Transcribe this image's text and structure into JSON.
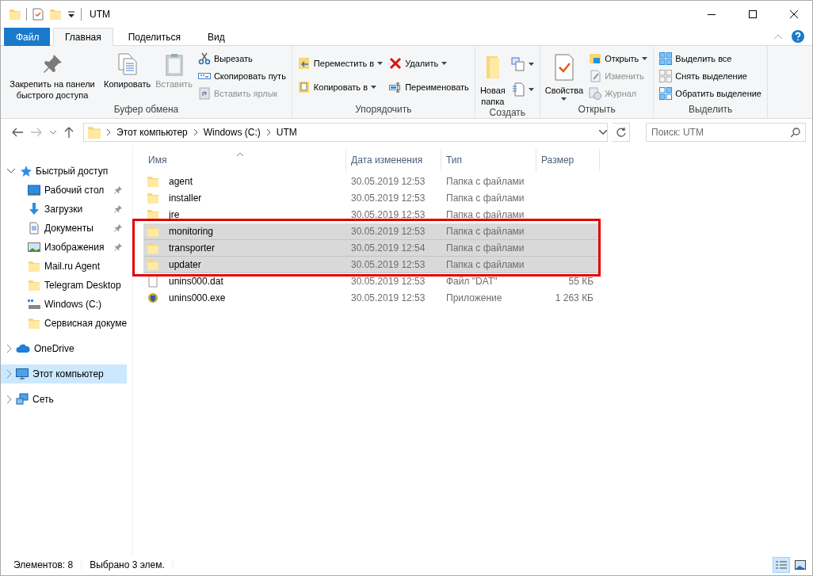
{
  "window": {
    "title": "UTM"
  },
  "ribbon_tabs": [
    {
      "label": "Файл",
      "kind": "file",
      "selected": false
    },
    {
      "label": "Главная",
      "kind": "tab",
      "selected": true
    },
    {
      "label": "Поделиться",
      "kind": "tab",
      "selected": false
    },
    {
      "label": "Вид",
      "kind": "tab",
      "selected": false
    }
  ],
  "ribbon_groups": [
    {
      "label": "Буфер обмена",
      "large": [
        {
          "label": "Закрепить на панели быстрого доступа",
          "kind": "pin",
          "disabled": false,
          "dropdown": false
        },
        {
          "label": "Копировать",
          "kind": "copy",
          "disabled": false,
          "dropdown": false
        },
        {
          "label": "Вставить",
          "kind": "paste",
          "disabled": true,
          "dropdown": false
        }
      ],
      "small": [
        [
          {
            "label": "Вырезать",
            "kind": "cut",
            "disabled": false,
            "dropdown": false
          },
          {
            "label": "Скопировать путь",
            "kind": "path",
            "disabled": false,
            "dropdown": false
          },
          {
            "label": "Вставить ярлык",
            "kind": "shortcut",
            "disabled": true,
            "dropdown": false
          }
        ]
      ]
    },
    {
      "label": "Упорядочить",
      "small": [
        [
          {
            "label": "Переместить в",
            "kind": "move",
            "disabled": false,
            "dropdown": true
          },
          {
            "label": "Копировать в",
            "kind": "copyto",
            "disabled": false,
            "dropdown": true
          }
        ],
        [
          {
            "label": "Удалить",
            "kind": "delete",
            "disabled": false,
            "dropdown": true
          },
          {
            "label": "Переименовать",
            "kind": "rename",
            "disabled": false,
            "dropdown": false
          }
        ]
      ]
    },
    {
      "label": "Создать",
      "large": [
        {
          "label": "Новая папка",
          "kind": "newfolder",
          "disabled": false,
          "dropdown": false
        }
      ],
      "small": [
        [
          {
            "kind": "newitem",
            "dropdown": true
          },
          {
            "kind": "easyaccess",
            "dropdown": true
          }
        ]
      ]
    },
    {
      "label": "Открыть",
      "large": [
        {
          "label": "Свойства",
          "kind": "properties",
          "disabled": false,
          "dropdown": true
        }
      ],
      "small": [
        [
          {
            "label": "Открыть",
            "kind": "open",
            "disabled": false,
            "dropdown": true
          },
          {
            "label": "Изменить",
            "kind": "edit",
            "disabled": true,
            "dropdown": false
          },
          {
            "label": "Журнал",
            "kind": "history",
            "disabled": true,
            "dropdown": false
          }
        ]
      ]
    },
    {
      "label": "Выделить",
      "small": [
        [
          {
            "label": "Выделить все",
            "kind": "selectall",
            "disabled": false,
            "dropdown": false
          },
          {
            "label": "Снять выделение",
            "kind": "selectnone",
            "disabled": false,
            "dropdown": false
          },
          {
            "label": "Обратить выделение",
            "kind": "invert",
            "disabled": false,
            "dropdown": false
          }
        ]
      ]
    }
  ],
  "address": {
    "path": [
      "Этот компьютер",
      "Windows (C:)",
      "UTM"
    ]
  },
  "search": {
    "placeholder": "Поиск: UTM"
  },
  "sidebar": [
    {
      "label": "Быстрый доступ",
      "kind": "star",
      "expanded": true,
      "selected": false,
      "children": [
        {
          "label": "Рабочий стол",
          "kind": "desktop",
          "pinned": true,
          "selected": false
        },
        {
          "label": "Загрузки",
          "kind": "download",
          "pinned": true,
          "selected": false
        },
        {
          "label": "Документы",
          "kind": "document",
          "pinned": true,
          "selected": false
        },
        {
          "label": "Изображения",
          "kind": "image",
          "pinned": true,
          "selected": false
        },
        {
          "label": "Mail.ru Agent",
          "kind": "folder",
          "pinned": false,
          "selected": false
        },
        {
          "label": "Telegram Desktop",
          "kind": "folder",
          "pinned": false,
          "selected": false
        },
        {
          "label": "Windows (C:)",
          "kind": "drive",
          "pinned": false,
          "selected": false
        },
        {
          "label": "Сервисная докуме",
          "kind": "folder",
          "pinned": false,
          "selected": false
        }
      ]
    },
    {
      "label": "OneDrive",
      "kind": "cloud",
      "expanded": false,
      "selected": false
    },
    {
      "label": "Этот компьютер",
      "kind": "computer",
      "expanded": false,
      "selected": true
    },
    {
      "label": "Сеть",
      "kind": "network",
      "expanded": false,
      "selected": false
    }
  ],
  "table": {
    "columns": [
      "Имя",
      "Дата изменения",
      "Тип",
      "Размер"
    ],
    "rows": [
      {
        "kind": "folder",
        "name": "agent",
        "date": "30.05.2019 12:53",
        "type": "Папка с файлами",
        "selected": false
      },
      {
        "kind": "folder",
        "name": "installer",
        "date": "30.05.2019 12:53",
        "type": "Папка с файлами",
        "selected": false
      },
      {
        "kind": "folder",
        "name": "jre",
        "date": "30.05.2019 12:53",
        "type": "Папка с файлами",
        "selected": false
      },
      {
        "kind": "folder",
        "name": "monitoring",
        "date": "30.05.2019 12:53",
        "type": "Папка с файлами",
        "selected": true
      },
      {
        "kind": "folder",
        "name": "transporter",
        "date": "30.05.2019 12:54",
        "type": "Папка с файлами",
        "selected": true
      },
      {
        "kind": "folder",
        "name": "updater",
        "date": "30.05.2019 12:53",
        "type": "Папка с файлами",
        "selected": true
      },
      {
        "kind": "file",
        "name": "unins000.dat",
        "date": "30.05.2019 12:53",
        "type": "Файл \"DAT\"",
        "size": "55 КБ",
        "selected": false
      },
      {
        "kind": "exe",
        "name": "unins000.exe",
        "date": "30.05.2019 12:53",
        "type": "Приложение",
        "size": "1 263 КБ",
        "selected": false
      }
    ]
  },
  "highlight_frame": {
    "color": "#e00000"
  },
  "status_bar": {
    "count": "Элементов: 8",
    "selection": "Выбрано 3 элем.",
    "views": [
      {
        "kind": "details",
        "selected": true
      },
      {
        "kind": "tiles",
        "selected": false
      }
    ]
  }
}
